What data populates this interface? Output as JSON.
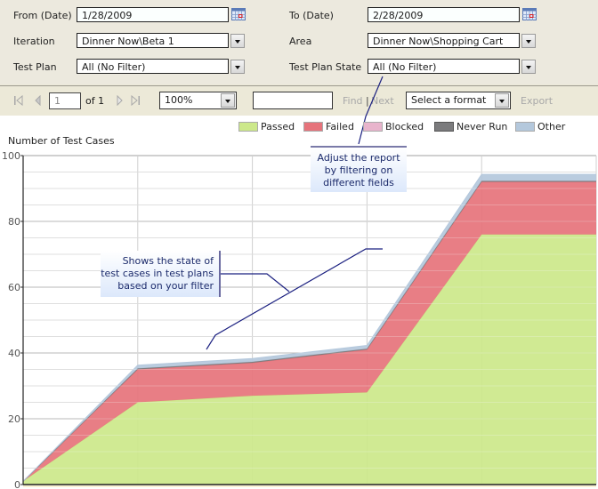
{
  "params": {
    "from_date": {
      "label": "From (Date)",
      "value": "1/28/2009"
    },
    "to_date": {
      "label": "To (Date)",
      "value": "2/28/2009"
    },
    "iteration": {
      "label": "Iteration",
      "value": "Dinner Now\\Beta 1"
    },
    "area": {
      "label": "Area",
      "value": "Dinner Now\\Shopping Cart"
    },
    "test_plan": {
      "label": "Test Plan",
      "value": "All (No Filter)"
    },
    "test_plan_state": {
      "label": "Test Plan State",
      "value": "All (No Filter)"
    }
  },
  "toolbar": {
    "page_value": "1",
    "page_of": "of 1",
    "zoom_value": "100%",
    "find_value": "",
    "find_label": "Find",
    "separator": "|",
    "next_label": "Next",
    "format_value": "Select a format",
    "export_label": "Export"
  },
  "callouts": {
    "filter": "Adjust the report by filtering on different fields",
    "state": "Shows the state of test cases in test plans based on your filter"
  },
  "icons": {
    "calendar": "calendar-icon",
    "first_page": "first-page-icon",
    "prev_page": "previous-page-icon",
    "next_page": "next-page-icon",
    "last_page": "last-page-icon"
  },
  "chart_data": {
    "type": "area",
    "stacked": true,
    "title": "",
    "ylabel": "Number of Test Cases",
    "xlabel": "",
    "ylim": [
      0,
      100
    ],
    "yticks": [
      0,
      20,
      40,
      60,
      80,
      100
    ],
    "x": [
      0,
      1,
      2,
      3,
      4,
      5
    ],
    "grid": true,
    "legend_position": "top-right",
    "series": [
      {
        "name": "Passed",
        "color": "#cce88a",
        "values": [
          1,
          25,
          27,
          28,
          76,
          76
        ]
      },
      {
        "name": "Failed",
        "color": "#e6737b",
        "values": [
          0,
          10,
          10,
          13,
          16,
          16
        ]
      },
      {
        "name": "Blocked",
        "color": "#e8b4cc",
        "values": [
          0,
          0,
          0,
          0,
          0,
          0
        ]
      },
      {
        "name": "Never Run",
        "color": "#7b7b7d",
        "values": [
          0,
          0.3,
          0.3,
          0.3,
          0.3,
          0.3
        ]
      },
      {
        "name": "Other",
        "color": "#b4c8dc",
        "values": [
          0,
          1,
          1,
          1,
          2,
          2
        ]
      }
    ]
  }
}
